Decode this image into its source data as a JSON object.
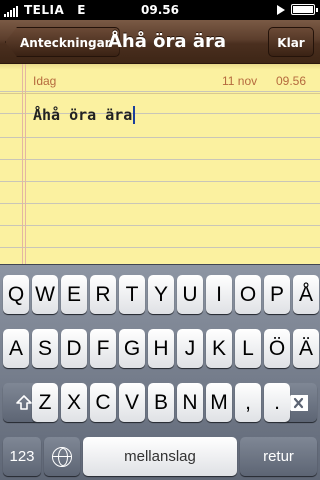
{
  "status_bar": {
    "carrier": "TELIA",
    "network": "E",
    "time": "09.56",
    "battery_level": 1.0
  },
  "nav": {
    "back_label": "Anteckningar",
    "title": "Åhå öra ära",
    "done_label": "Klar"
  },
  "note": {
    "date_label": "Idag",
    "date": "11 nov",
    "time": "09.56",
    "body": "Åhå öra ära"
  },
  "keyboard": {
    "row1": [
      "Q",
      "W",
      "E",
      "R",
      "T",
      "Y",
      "U",
      "I",
      "O",
      "P",
      "Å"
    ],
    "row2": [
      "A",
      "S",
      "D",
      "F",
      "G",
      "H",
      "J",
      "K",
      "L",
      "Ö",
      "Ä"
    ],
    "row3": [
      "Z",
      "X",
      "C",
      "V",
      "B",
      "N",
      "M",
      ",",
      "."
    ],
    "numbers_label": "123",
    "space_label": "mellanslag",
    "return_label": "retur",
    "icons": {
      "shift": "shift-icon",
      "backspace": "backspace-icon",
      "globe": "globe-icon"
    }
  },
  "colors": {
    "nav_brown": "#5c3e2c",
    "paper_yellow": "#fbf1a0",
    "date_brown": "#b56a3e",
    "cursor_blue": "#1b3f9c"
  }
}
